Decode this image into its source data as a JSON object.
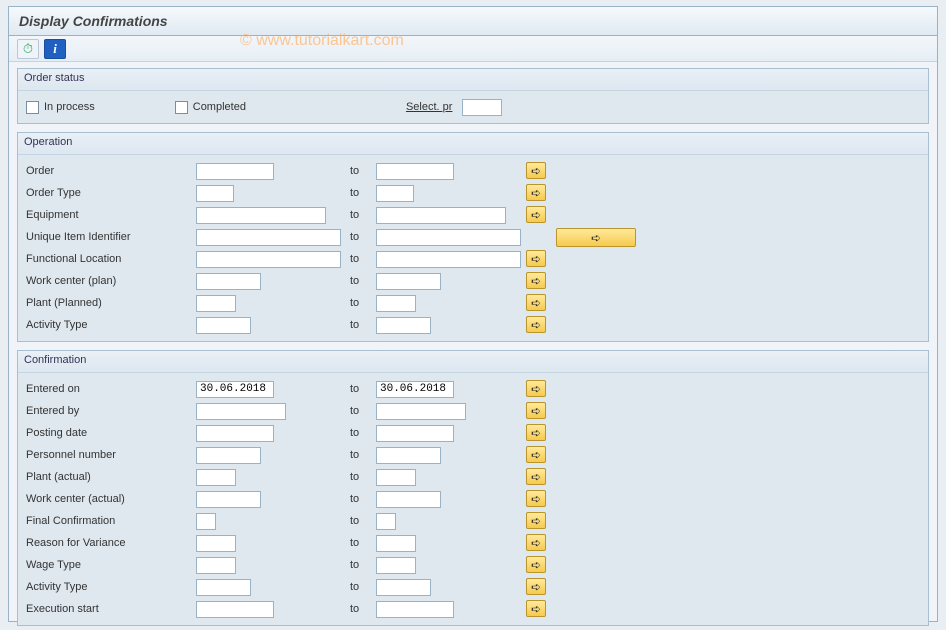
{
  "watermark": "© www.tutorialkart.com",
  "title": "Display Confirmations",
  "toolbar": {
    "execute_icon": "execute",
    "info_icon": "i"
  },
  "groups": {
    "order_status": {
      "title": "Order status",
      "in_process_label": "In process",
      "completed_label": "Completed",
      "select_pr_label": "Select. pr",
      "select_pr_value": ""
    },
    "operation": {
      "title": "Operation",
      "to_label": "to",
      "rows": [
        {
          "label": "Order",
          "from": "",
          "to": "",
          "w_from": 78,
          "w_to": 78,
          "more": "std"
        },
        {
          "label": "Order Type",
          "from": "",
          "to": "",
          "w_from": 38,
          "w_to": 38,
          "more": "std"
        },
        {
          "label": "Equipment",
          "from": "",
          "to": "",
          "w_from": 130,
          "w_to": 130,
          "more": "std"
        },
        {
          "label": "Unique Item Identifier",
          "from": "",
          "to": "",
          "w_from": 145,
          "w_to": 145,
          "more": "wide"
        },
        {
          "label": "Functional Location",
          "from": "",
          "to": "",
          "w_from": 145,
          "w_to": 145,
          "more": "std"
        },
        {
          "label": "Work center (plan)",
          "from": "",
          "to": "",
          "w_from": 65,
          "w_to": 65,
          "more": "std"
        },
        {
          "label": "Plant (Planned)",
          "from": "",
          "to": "",
          "w_from": 40,
          "w_to": 40,
          "more": "std"
        },
        {
          "label": "Activity Type",
          "from": "",
          "to": "",
          "w_from": 55,
          "w_to": 55,
          "more": "std"
        }
      ]
    },
    "confirmation": {
      "title": "Confirmation",
      "to_label": "to",
      "rows": [
        {
          "label": "Entered on",
          "from": "30.06.2018",
          "to": "30.06.2018",
          "w_from": 78,
          "w_to": 78,
          "more": "std"
        },
        {
          "label": "Entered by",
          "from": "",
          "to": "",
          "w_from": 90,
          "w_to": 90,
          "more": "std"
        },
        {
          "label": "Posting date",
          "from": "",
          "to": "",
          "w_from": 78,
          "w_to": 78,
          "more": "std"
        },
        {
          "label": "Personnel number",
          "from": "",
          "to": "",
          "w_from": 65,
          "w_to": 65,
          "more": "std"
        },
        {
          "label": "Plant (actual)",
          "from": "",
          "to": "",
          "w_from": 40,
          "w_to": 40,
          "more": "std"
        },
        {
          "label": "Work center (actual)",
          "from": "",
          "to": "",
          "w_from": 65,
          "w_to": 65,
          "more": "std"
        },
        {
          "label": "Final Confirmation",
          "from": "",
          "to": "",
          "w_from": 20,
          "w_to": 20,
          "more": "std"
        },
        {
          "label": "Reason for Variance",
          "from": "",
          "to": "",
          "w_from": 40,
          "w_to": 40,
          "more": "std"
        },
        {
          "label": "Wage Type",
          "from": "",
          "to": "",
          "w_from": 40,
          "w_to": 40,
          "more": "std"
        },
        {
          "label": "Activity Type",
          "from": "",
          "to": "",
          "w_from": 55,
          "w_to": 55,
          "more": "std"
        },
        {
          "label": "Execution start",
          "from": "",
          "to": "",
          "w_from": 78,
          "w_to": 78,
          "more": "std"
        }
      ]
    }
  }
}
